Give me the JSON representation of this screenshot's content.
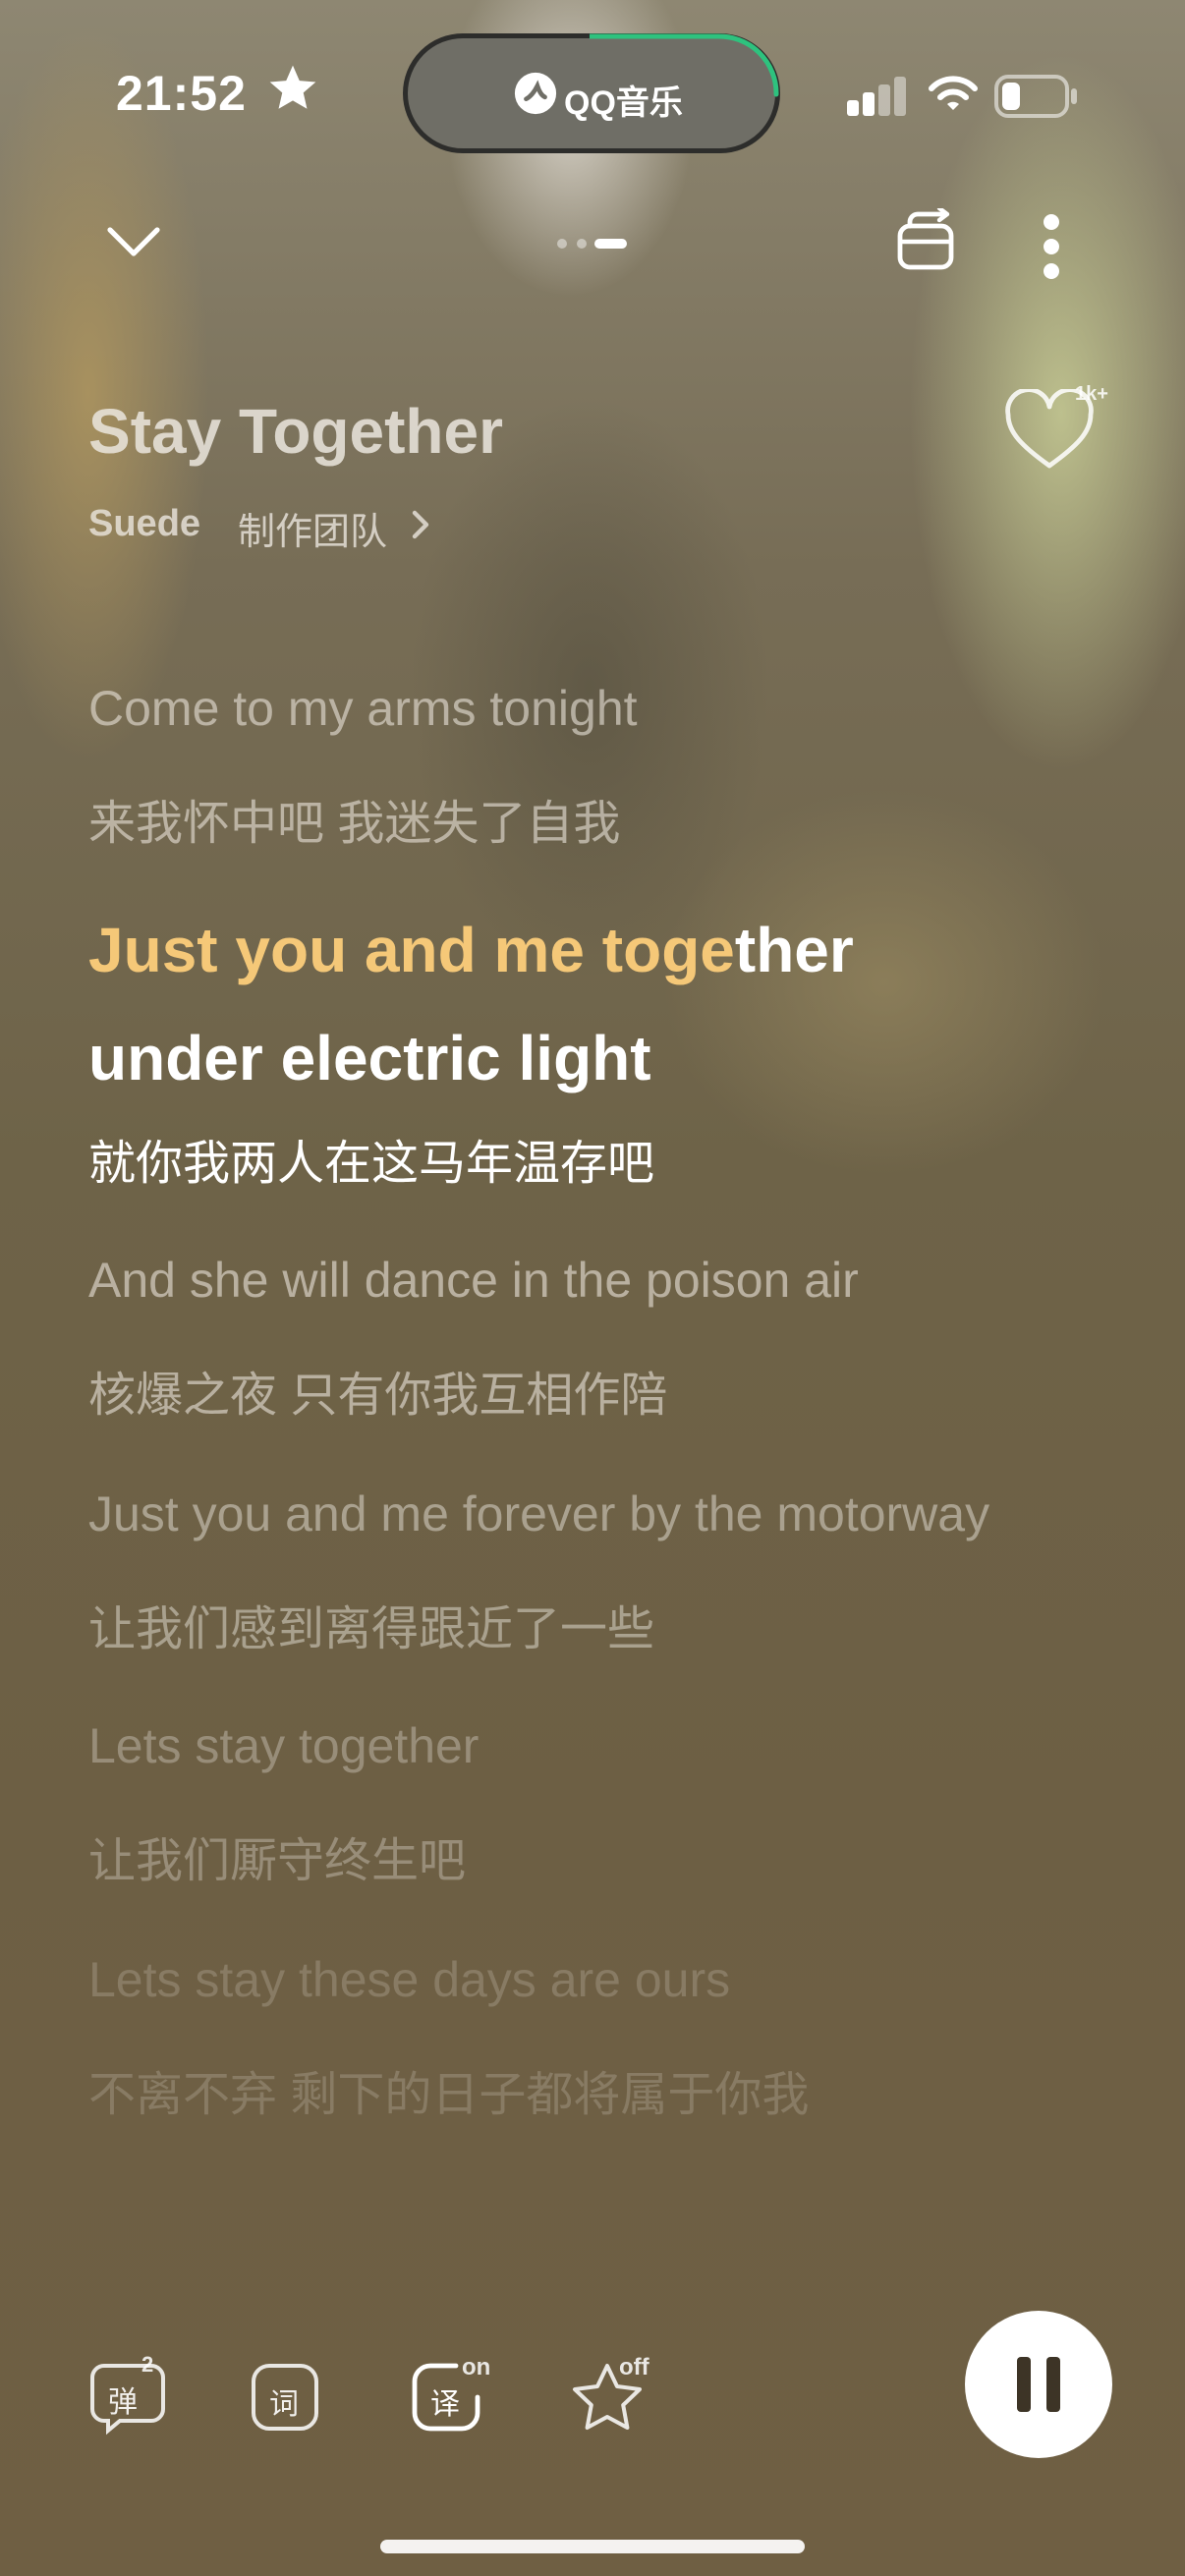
{
  "status_bar": {
    "time": "21:52",
    "island_label": "QQ音乐",
    "accent_color": "#2ec27e"
  },
  "header": {
    "page_indicator_count": 3,
    "active_page_index": 3
  },
  "song": {
    "title": "Stay Together",
    "artist": "Suede",
    "team_label": "制作团队",
    "like_count": "1k+"
  },
  "lyrics": [
    {
      "en": "Come to my arms tonight",
      "zh": "来我怀中吧 我迷失了自我"
    },
    {
      "en_sung": "Just you and me toge",
      "en_rest": "ther",
      "en_line2": "under electric light",
      "zh": "就你我两人在这马年温存吧"
    },
    {
      "en": "And she will dance in the poison air",
      "zh": "核爆之夜 只有你我互相作陪"
    },
    {
      "en": "Just you and me forever by the motorway",
      "zh": "让我们感到离得跟近了一些"
    },
    {
      "en": "Lets stay together",
      "zh": "让我们厮守终生吧"
    },
    {
      "en": "Lets stay these days are ours",
      "zh": "不离不弃 剩下的日子都将属于你我"
    }
  ],
  "controls": {
    "danmu_label": "弹",
    "danmu_count": "2",
    "lyrics_label": "词",
    "translate_label": "译",
    "translate_state": "on",
    "favorite_state": "off",
    "highlight_color": "#f5c878"
  }
}
